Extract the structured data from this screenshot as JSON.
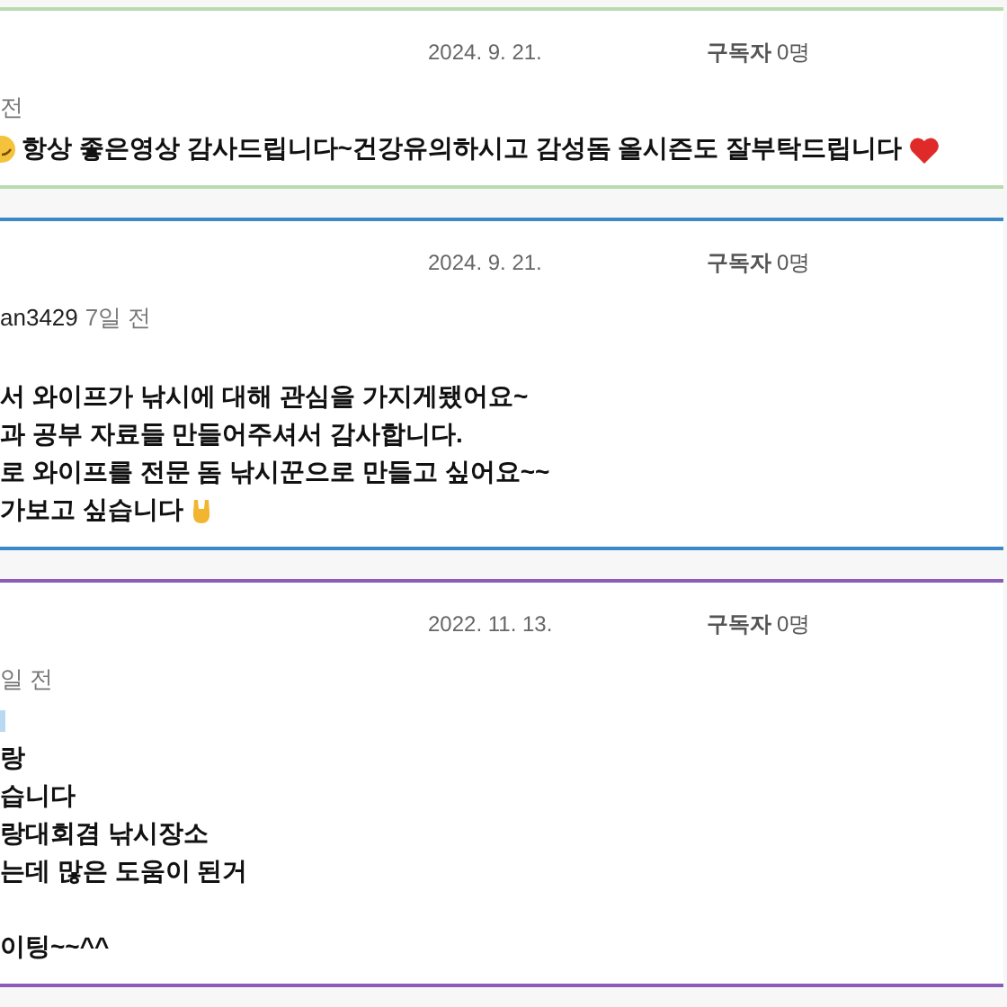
{
  "comments": [
    {
      "color": "#b9dcae",
      "date": "2024. 9. 21.",
      "subscribers_label": "구독자",
      "subscribers_count": "0명",
      "time": "전",
      "lines": [
        {
          "kind": "smile_heart",
          "text": "항상 좋은영상 감사드립니다~건강유의하시고 감성돔 올시즌도 잘부탁드립니다"
        }
      ]
    },
    {
      "color": "#3c89c9",
      "date": "2024. 9. 21.",
      "subscribers_label": "구독자",
      "subscribers_count": "0명",
      "author": "an3429",
      "time": "7일 전",
      "lines": [
        {
          "kind": "blank"
        },
        {
          "kind": "plain",
          "text": "서 와이프가 낚시에 대해 관심을 가지게됐어요~"
        },
        {
          "kind": "plain",
          "text": "과 공부 자료들 만들어주셔서 감사합니다."
        },
        {
          "kind": "plain",
          "text": "로 와이프를 전문 돔 낚시꾼으로 만들고 싶어요~~"
        },
        {
          "kind": "hand",
          "text": "가보고 싶습니다"
        }
      ]
    },
    {
      "color": "#8b5cb8",
      "date": "2022. 11. 13.",
      "subscribers_label": "구독자",
      "subscribers_count": "0명",
      "time": "일 전",
      "lines": [
        {
          "kind": "mark"
        },
        {
          "kind": "plain",
          "text": "랑"
        },
        {
          "kind": "plain",
          "text": "습니다"
        },
        {
          "kind": "plain",
          "text": "랑대회겸 낚시장소"
        },
        {
          "kind": "plain",
          "text": "는데 많은 도움이 된거"
        },
        {
          "kind": "blank"
        },
        {
          "kind": "plain",
          "text": "이팅~~^^"
        }
      ]
    }
  ]
}
